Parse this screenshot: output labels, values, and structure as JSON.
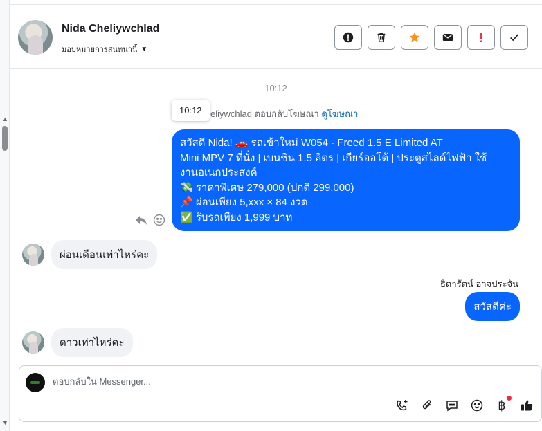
{
  "contact": {
    "name": "Nida Cheliywchlad",
    "assign_label": "มอบหมายการสนทนานี้"
  },
  "header_actions": [
    {
      "name": "report-icon",
      "label": "!"
    },
    {
      "name": "trash-icon"
    },
    {
      "name": "star-icon",
      "color": "#f7931e"
    },
    {
      "name": "mail-icon"
    },
    {
      "name": "spam-icon",
      "label": "!",
      "color": "#e41e3f"
    },
    {
      "name": "check-icon"
    }
  ],
  "chat": {
    "time_center": "10:12",
    "tooltip_time": "10:12",
    "reply_note_text": "eliywchlad ตอบกลับโฆษณา",
    "reply_note_link": "ดูโฆษณา",
    "outgoing_ad_message": {
      "line1": "สวัสดี Nida! 🚗 รถเข้าใหม่ W054 - Freed 1.5 E Limited AT",
      "line2": "Mini MPV 7 ที่นั่ง | เบนซิน 1.5 ลิตร | เกียร์ออโต้ | ประตูสไลด์ไฟฟ้า ใช้",
      "line3": "งานอเนกประสงค์",
      "line4": "💸 ราคาพิเศษ 279,000 (ปกติ 299,000)",
      "line5": "📌 ผ่อนเพียง 5,xxx × 84 งวด",
      "line6": "✅ รับรถเพียง 1,999 บาท"
    },
    "incoming_1": "ผ่อนเดือนเท่าไหร่คะ",
    "sender_name": "ธิดารัตน์ อาจประจัน",
    "outgoing_reply": "สวัสดีค่ะ",
    "incoming_2": "ดาวเท่าไหร่คะ"
  },
  "composer": {
    "placeholder": "ตอบกลับใน Messenger...",
    "currency_symbol": "฿"
  },
  "colors": {
    "accent_blue": "#0866ff",
    "bubble_grey": "#f0f2f5",
    "link": "#0a66c2",
    "star": "#f7931e",
    "alert_red": "#e41e3f"
  }
}
